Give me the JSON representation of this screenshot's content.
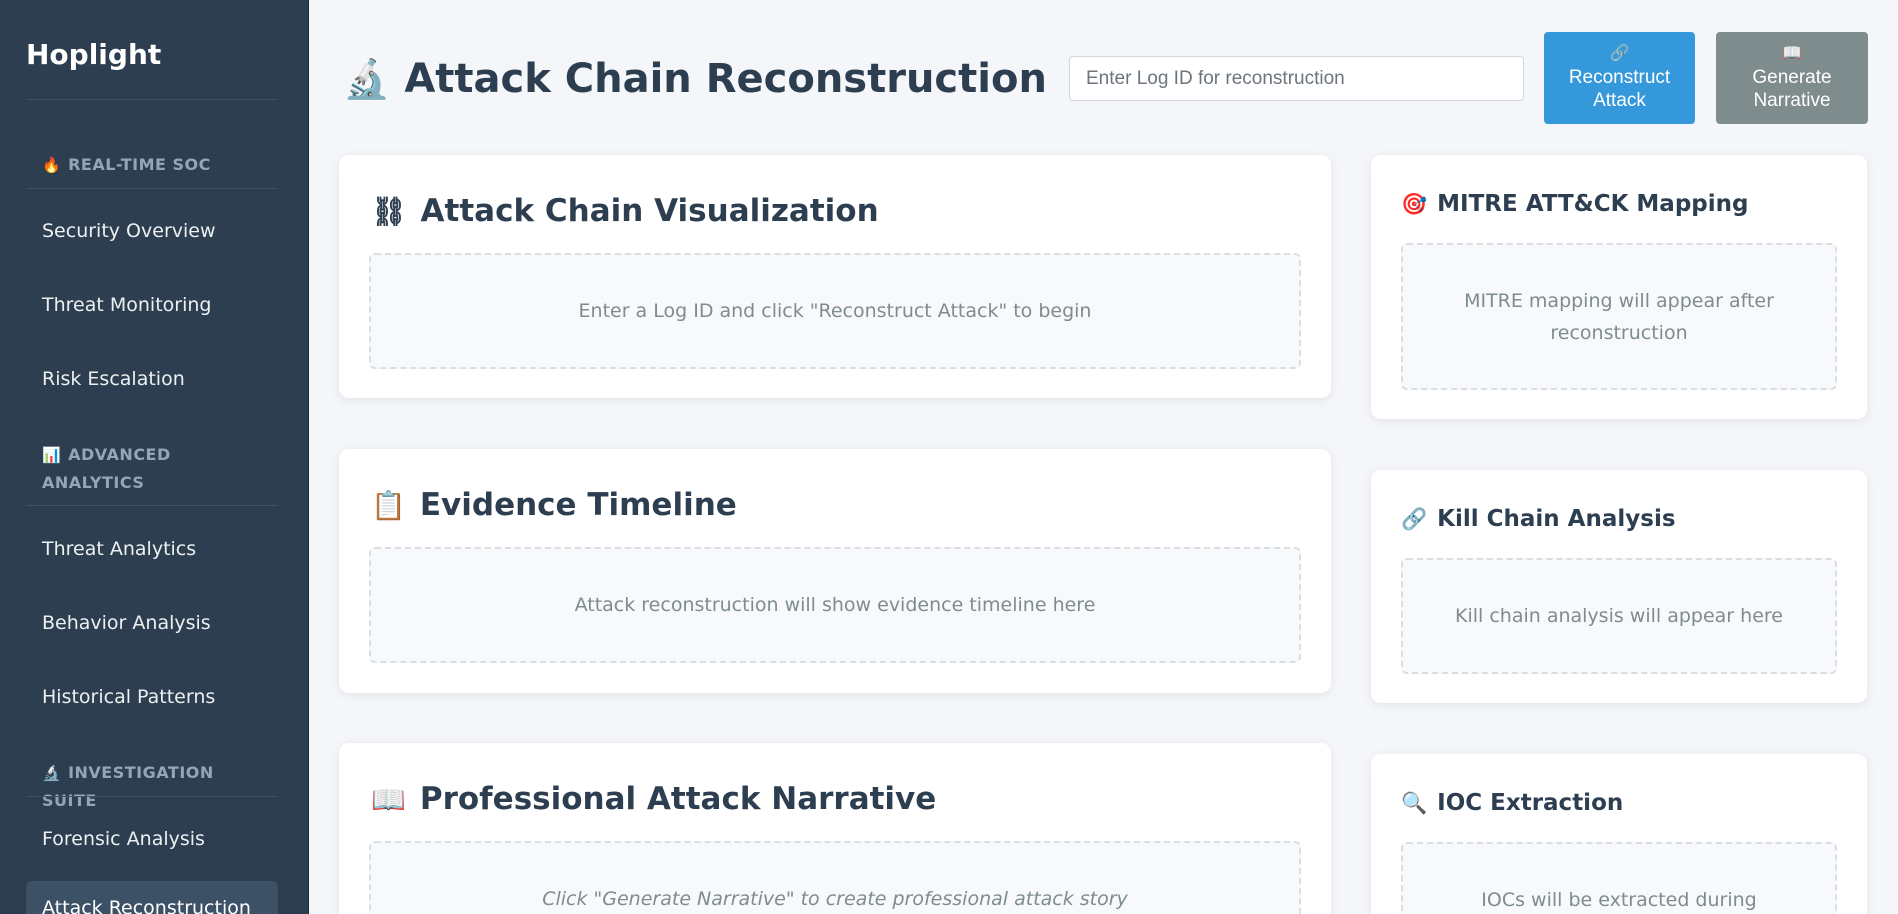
{
  "app": {
    "brand": "Hoplight"
  },
  "sidebar": {
    "sections": [
      {
        "icon": "🔥",
        "label": "REAL-TIME SOC"
      },
      {
        "icon": "📊",
        "label": "ADVANCED ANALYTICS"
      },
      {
        "icon": "🔬",
        "label": "INVESTIGATION SUITE"
      }
    ],
    "items": [
      {
        "label": "Security Overview"
      },
      {
        "label": "Threat Monitoring"
      },
      {
        "label": "Risk Escalation"
      },
      {
        "label": "Threat Analytics"
      },
      {
        "label": "Behavior Analysis"
      },
      {
        "label": "Historical Patterns"
      },
      {
        "label": "Forensic Analysis"
      },
      {
        "label": "Attack Reconstruction"
      }
    ]
  },
  "header": {
    "icon": "🔬",
    "title": "Attack Chain Reconstruction",
    "log_input": {
      "placeholder": "Enter Log ID for reconstruction",
      "value": ""
    },
    "reconstruct_button": {
      "icon": "🔗",
      "line1": "Reconstruct",
      "line2": "Attack"
    },
    "narrative_button": {
      "icon": "📖",
      "line1": "Generate",
      "line2": "Narrative"
    }
  },
  "cards": {
    "visualization": {
      "icon": "⛓",
      "title": "Attack Chain Visualization",
      "placeholder": "Enter a Log ID and click \"Reconstruct Attack\" to begin"
    },
    "timeline": {
      "icon": "📋",
      "title": "Evidence Timeline",
      "placeholder": "Attack reconstruction will show evidence timeline here"
    },
    "narrative": {
      "icon": "📖",
      "title": "Professional Attack Narrative",
      "placeholder": "Click \"Generate Narrative\" to create professional attack story"
    },
    "mitre": {
      "icon": "🎯",
      "title": "MITRE ATT&CK Mapping",
      "placeholder_line1": "MITRE mapping will appear after",
      "placeholder_line2": "reconstruction"
    },
    "kill_chain": {
      "icon": "🔗",
      "title": "Kill Chain Analysis",
      "placeholder": "Kill chain analysis will appear here"
    },
    "ioc": {
      "icon": "🔍",
      "title": "IOC Extraction",
      "placeholder": "IOCs will be extracted during"
    }
  }
}
